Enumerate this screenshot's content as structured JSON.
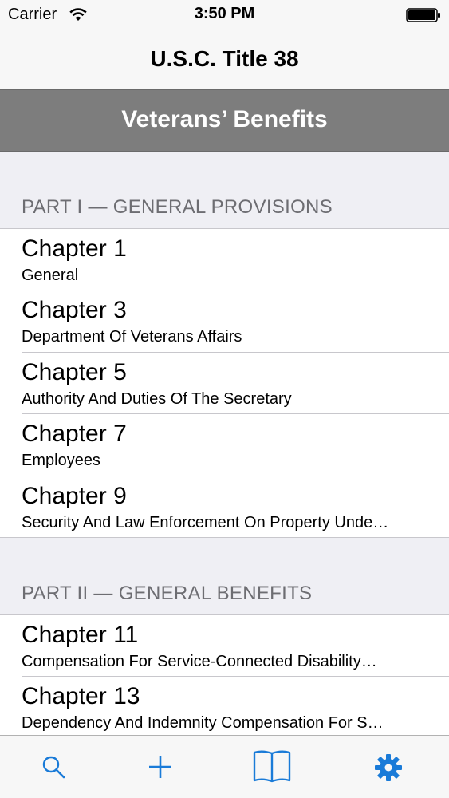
{
  "status_bar": {
    "carrier": "Carrier",
    "time": "3:50 PM"
  },
  "nav": {
    "title": "U.S.C. Title 38"
  },
  "banner": {
    "title": "Veterans’ Benefits"
  },
  "sections": [
    {
      "header": "PART I — GENERAL PROVISIONS",
      "rows": [
        {
          "title": "Chapter 1",
          "subtitle": "General"
        },
        {
          "title": "Chapter 3",
          "subtitle": "Department Of Veterans Affairs"
        },
        {
          "title": "Chapter 5",
          "subtitle": "Authority And Duties Of The Secretary"
        },
        {
          "title": "Chapter 7",
          "subtitle": "Employees"
        },
        {
          "title": "Chapter 9",
          "subtitle": "Security And Law Enforcement On Property Unde…"
        }
      ]
    },
    {
      "header": "PART II — GENERAL BENEFITS",
      "rows": [
        {
          "title": "Chapter 11",
          "subtitle": "Compensation For Service-Connected Disability…"
        },
        {
          "title": "Chapter 13",
          "subtitle": "Dependency And Indemnity Compensation For S…"
        }
      ]
    }
  ],
  "tab_bar": {
    "tint_color": "#1a7bd8",
    "tabs": [
      {
        "icon": "search-icon"
      },
      {
        "icon": "plus-icon"
      },
      {
        "icon": "book-icon"
      },
      {
        "icon": "gear-icon"
      }
    ]
  }
}
